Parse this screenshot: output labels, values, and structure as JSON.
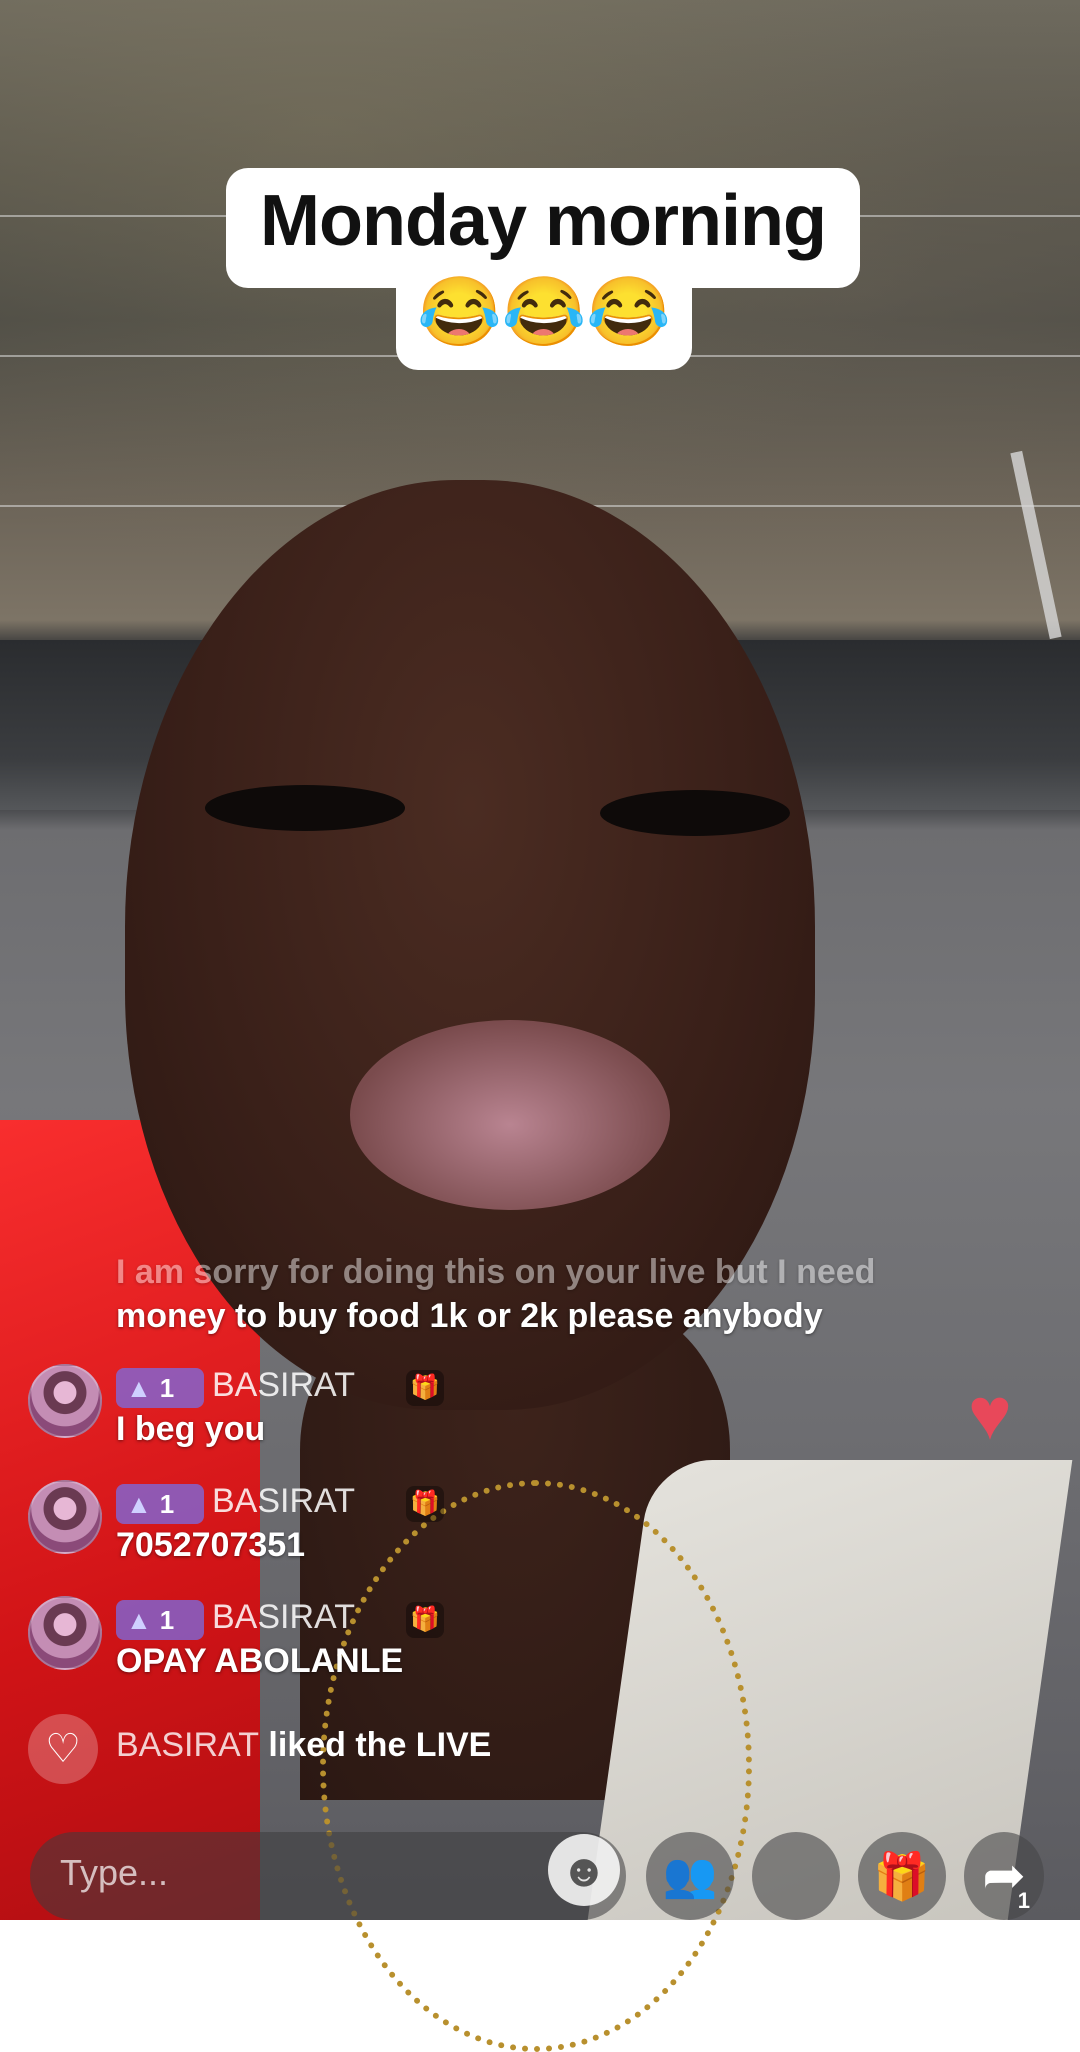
{
  "caption": {
    "title": "Monday morning",
    "emoji": "😂😂😂"
  },
  "comments": {
    "top_faded_text": "I am sorry for doing this on your live but I need",
    "top_text": "money to buy food 1k or 2k please anybody",
    "rows": [
      {
        "badge_level": "1",
        "username": "BASIRAT",
        "message": "I beg you"
      },
      {
        "badge_level": "1",
        "username": "BASIRAT",
        "message": "7052707351"
      },
      {
        "badge_level": "1",
        "username": "BASIRAT",
        "message": "OPAY ABOLANLE"
      }
    ],
    "liked": {
      "username": "BASIRAT",
      "action": "liked the LIVE"
    }
  },
  "bottom_bar": {
    "type_placeholder": "Type...",
    "share_count": "1",
    "icons": [
      "smiley-icon",
      "multi-guest-icon",
      "blank-button",
      "gift-icon",
      "share-icon"
    ]
  },
  "colors": {
    "accent_pink": "#ff2c80",
    "heart_red": "#e8485a",
    "badge_purple": "#7a6ee6"
  }
}
